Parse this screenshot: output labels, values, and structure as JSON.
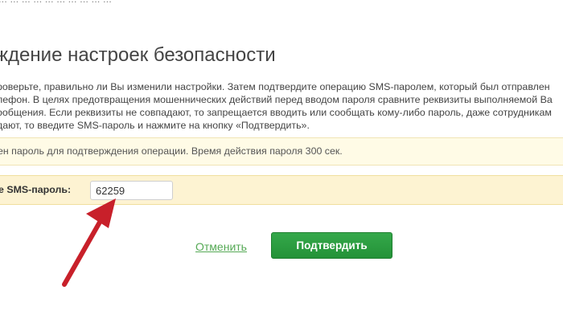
{
  "header": {
    "partial_text": "... ... ... ... ... ... ... ... ... ...",
    "title": "ждение настроек безопасности"
  },
  "description": {
    "lines": [
      "роверьте, правильно ли Вы изменили настройки. Затем подтвердите операцию SMS-паролем, который был отправлен",
      "лефон. В целях предотвращения мошеннических действий перед вводом пароля сравните реквизиты выполняемой Ва",
      "ообщения. Если реквизиты не совпадают, то запрещается вводить или сообщать кому-либо пароль, даже сотрудникам",
      "дают, то введите SMS-пароль и нажмите на кнопку «Подтвердить»."
    ]
  },
  "notice": {
    "text": "ен пароль для подтверждения операции. Время действия пароля 300 сек."
  },
  "sms_form": {
    "label": "е SMS-пароль:",
    "value": "62259"
  },
  "actions": {
    "cancel_label": "Отменить",
    "confirm_label": "Подтвердить"
  },
  "colors": {
    "accent_green": "#2b9c3f",
    "link_green": "#55a955",
    "arrow_red": "#c8202a",
    "notice_bg": "#fffbe6",
    "input_row_bg": "#fdf3d2"
  },
  "annotation": {
    "icon": "red-arrow-icon"
  }
}
